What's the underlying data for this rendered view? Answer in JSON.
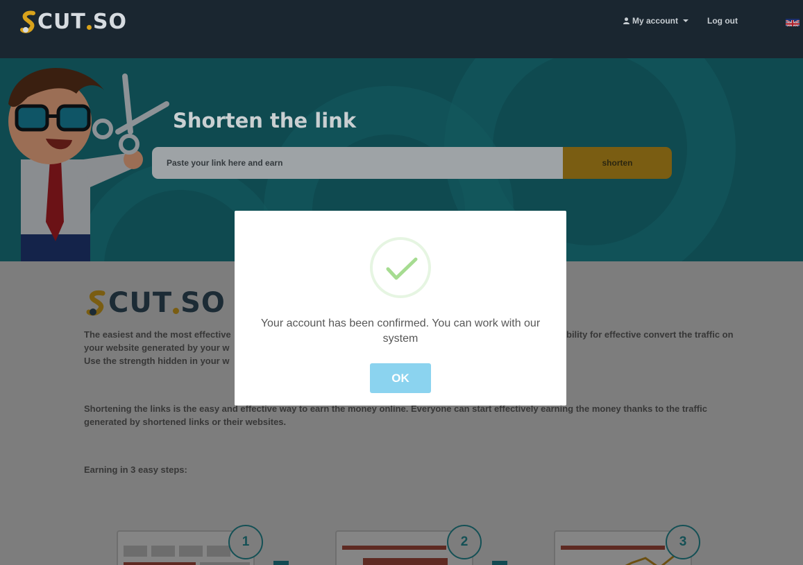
{
  "nav": {
    "brand": "CUT",
    "brand_suffix": "SO",
    "account_label": "My account",
    "logout_label": "Log out",
    "language_flag": "uk-flag-icon"
  },
  "hero": {
    "title": "Shorten the link",
    "input_placeholder": "Paste your link here and earn",
    "shorten_label": "shorten"
  },
  "content": {
    "brand": "CUT",
    "brand_suffix": "SO",
    "intro_line1_start": "The easiest and the most effective",
    "intro_line1_end": "bility for effective convert the traffic on",
    "intro_line2_start": "your website generated by your w",
    "intro_line3_start": "Use the strength hidden in your w",
    "shortening_paragraph": "Shortening the links is the easy and effective way to earn the money online. Everyone can start effectively earning the money thanks to the traffic generated by shortened links or their websites.",
    "steps_heading": "Earning in 3 easy steps:",
    "steps": [
      "1",
      "2",
      "3"
    ]
  },
  "modal": {
    "icon": "checkmark-icon",
    "message": "Your account has been confirmed. You can work with our system",
    "ok_label": "OK"
  },
  "colors": {
    "nav_bg": "#1a2630",
    "hero_bg": "#0f4a50",
    "accent_gold": "#d8a21b",
    "ok_button": "#8bd3ef",
    "check_green": "#a6dc91"
  }
}
